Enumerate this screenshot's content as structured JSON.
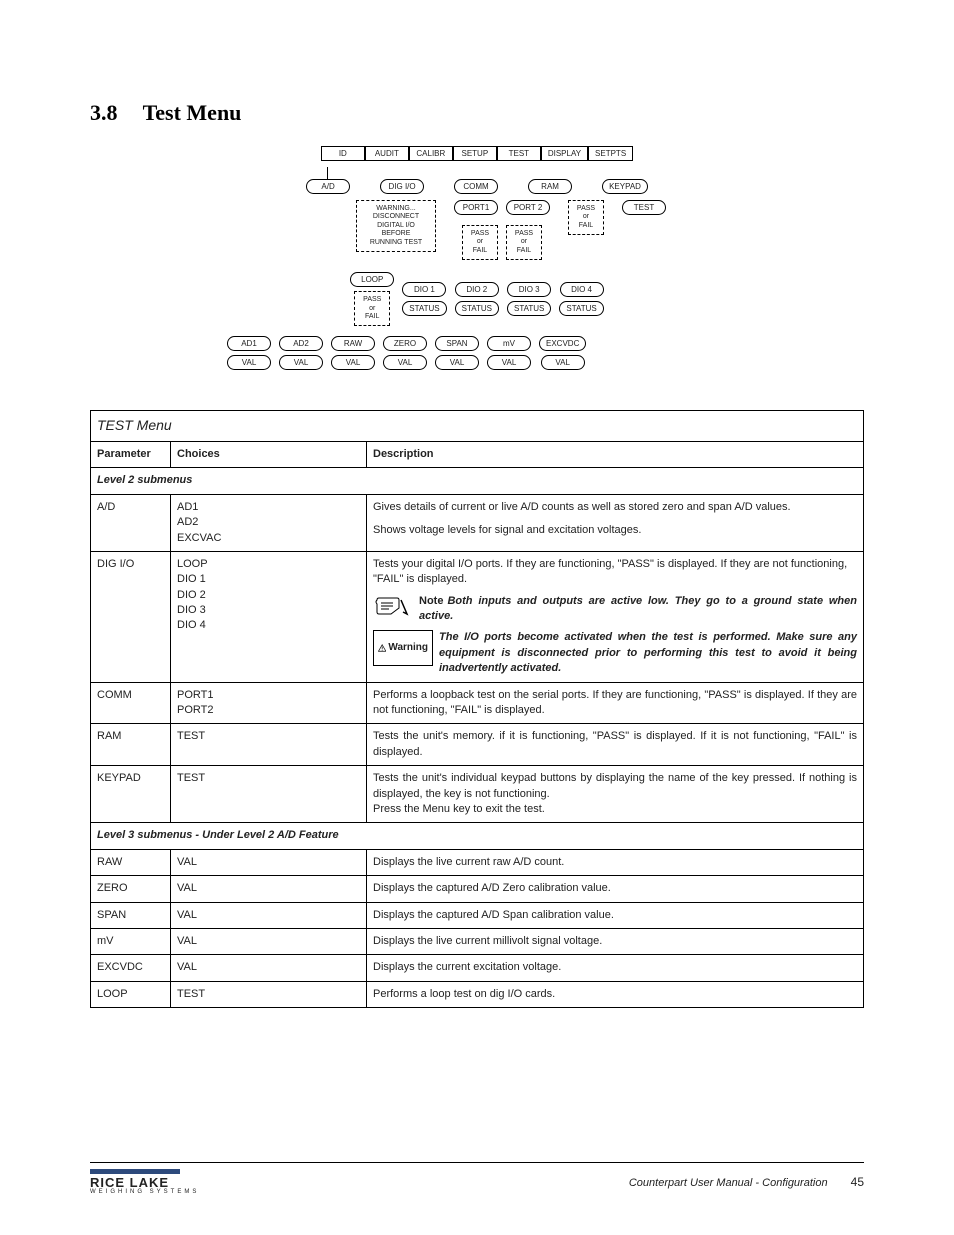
{
  "page": {
    "section_number": "3.8",
    "section_title": "Test Menu",
    "footer_title": "Counterpart User Manual - Configuration",
    "page_number": "45",
    "logo_main": "RICE LAKE",
    "logo_sub": "WEIGHING SYSTEMS"
  },
  "diagram": {
    "top_menu": [
      "ID",
      "AUDIT",
      "CALIBR",
      "SETUP",
      "TEST",
      "DISPLAY",
      "SETPTS"
    ],
    "level2": [
      "A/D",
      "DIG I/O",
      "COMM",
      "RAM",
      "KEYPAD"
    ],
    "digio_warn": "WARNING...\nDISCONNECT\nDIGITAL I/O\nBEFORE\nRUNNING TEST",
    "comm_children": [
      "PORT1",
      "PORT 2"
    ],
    "comm_result": "PASS\nor\nFAIL",
    "ram_result": "PASS\nor\nFAIL",
    "keypad_child": "TEST",
    "digio_children": [
      "LOOP",
      "DIO 1",
      "DIO 2",
      "DIO 3",
      "DIO 4"
    ],
    "loop_result": "PASS\nor\nFAIL",
    "status_label": "STATUS",
    "ad_children": [
      "AD1",
      "AD2",
      "RAW",
      "ZERO",
      "SPAN",
      "mV",
      "EXCVDC"
    ],
    "val_label": "VAL"
  },
  "table": {
    "title": "TEST Menu",
    "headers": {
      "param": "Parameter",
      "choices": "Choices",
      "desc": "Description"
    },
    "level2_header": "Level 2 submenus",
    "level3_header": "Level 3 submenus - Under Level 2 A/D Feature",
    "rows": [
      {
        "param": "A/D",
        "choices": "AD1\nAD2\nEXCVAC",
        "desc_top": "Gives details of current or live A/D counts as well as stored zero and span A/D values.",
        "desc_bottom": "Shows voltage levels for signal and excitation voltages."
      },
      {
        "param": "DIG I/O",
        "choices": "LOOP\nDIO 1\nDIO 2\nDIO 3\nDIO 4",
        "desc_top": "Tests your digital I/O ports. If they are functioning, \"PASS\" is displayed. If they are not functioning, \"FAIL\" is displayed.",
        "note_label": "Note",
        "note_text": "Both inputs and outputs are active low. They go to a ground state when active.",
        "warn_label": "Warning",
        "warn_text": "The I/O ports become activated when the test is performed. Make sure any equipment is disconnected prior to performing this test to avoid it being inadvertently activated."
      },
      {
        "param": "COMM",
        "choices": "PORT1\nPORT2",
        "desc": "Performs a loopback test on the serial ports. If they are functioning, \"PASS\" is displayed. If they are not functioning, \"FAIL\" is displayed."
      },
      {
        "param": "RAM",
        "choices": "TEST",
        "desc": "Tests the unit's memory. if it is functioning, \"PASS\" is displayed. If it is not functioning, \"FAIL\" is displayed."
      },
      {
        "param": "KEYPAD",
        "choices": "TEST",
        "desc": "Tests the unit's individual keypad buttons by displaying the name of the key pressed. If nothing is displayed, the key is not functioning.\nPress the Menu key to exit the test."
      }
    ],
    "level3_rows": [
      {
        "param": "RAW",
        "choices": "VAL",
        "desc": "Displays the live current raw A/D count."
      },
      {
        "param": "ZERO",
        "choices": "VAL",
        "desc": "Displays the captured A/D Zero calibration value."
      },
      {
        "param": "SPAN",
        "choices": "VAL",
        "desc": "Displays the captured A/D Span calibration value."
      },
      {
        "param": "mV",
        "choices": "VAL",
        "desc": "Displays the live current millivolt signal voltage."
      },
      {
        "param": "EXCVDC",
        "choices": "VAL",
        "desc": "Displays the current excitation voltage."
      },
      {
        "param": "LOOP",
        "choices": "TEST",
        "desc": "Performs a loop test on dig I/O cards."
      }
    ]
  },
  "chart_data": {
    "type": "table",
    "title": "TEST Menu",
    "columns": [
      "Parameter",
      "Choices",
      "Description"
    ],
    "sections": {
      "Level 2 submenus": [
        [
          "A/D",
          "AD1 AD2 EXCVAC",
          "Gives details of current or live A/D counts as well as stored zero and span A/D values. Shows voltage levels for signal and excitation voltages."
        ],
        [
          "DIG I/O",
          "LOOP DIO 1 DIO 2 DIO 3 DIO 4",
          "Tests your digital I/O ports. If they are functioning, \"PASS\" is displayed. If they are not functioning, \"FAIL\" is displayed. Note: Both inputs and outputs are active low. They go to a ground state when active. Warning: The I/O ports become activated when the test is performed. Make sure any equipment is disconnected prior to performing this test to avoid it being inadvertently activated."
        ],
        [
          "COMM",
          "PORT1 PORT2",
          "Performs a loopback test on the serial ports. If they are functioning, \"PASS\" is displayed. If they are not functioning, \"FAIL\" is displayed."
        ],
        [
          "RAM",
          "TEST",
          "Tests the unit's memory. if it is functioning, \"PASS\" is displayed. If it is not functioning, \"FAIL\" is displayed."
        ],
        [
          "KEYPAD",
          "TEST",
          "Tests the unit's individual keypad buttons by displaying the name of the key pressed. If nothing is displayed, the key is not functioning. Press the Menu key to exit the test."
        ]
      ],
      "Level 3 submenus - Under Level 2 A/D Feature": [
        [
          "RAW",
          "VAL",
          "Displays the live current raw A/D count."
        ],
        [
          "ZERO",
          "VAL",
          "Displays the captured A/D Zero calibration value."
        ],
        [
          "SPAN",
          "VAL",
          "Displays the captured A/D Span calibration value."
        ],
        [
          "mV",
          "VAL",
          "Displays the live current millivolt signal voltage."
        ],
        [
          "EXCVDC",
          "VAL",
          "Displays the current excitation voltage."
        ],
        [
          "LOOP",
          "TEST",
          "Performs a loop test on dig I/O cards."
        ]
      ]
    }
  }
}
